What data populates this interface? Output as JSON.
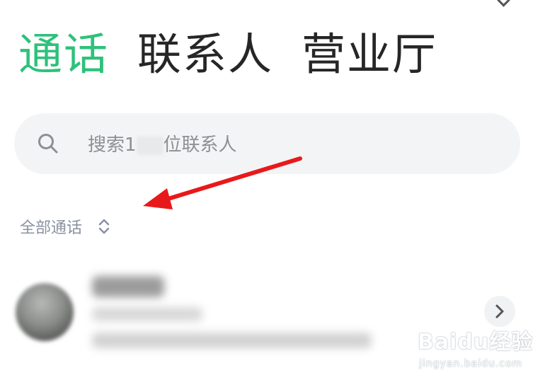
{
  "tabs": [
    {
      "label": "通话",
      "active": true
    },
    {
      "label": "联系人",
      "active": false
    },
    {
      "label": "营业厅",
      "active": false
    }
  ],
  "search": {
    "placeholder_prefix": "搜索1",
    "placeholder_suffix": "位联系人",
    "icon": "search-icon"
  },
  "filter": {
    "label": "全部通话",
    "icon": "sort-updown-icon"
  },
  "contact": {
    "name": "",
    "detail": "",
    "meta": ""
  },
  "colors": {
    "accent": "#2ec17b",
    "arrow": "#e8191b",
    "text": "#262626",
    "muted": "#8b92a3"
  },
  "watermark": {
    "brand": "Bai",
    "brand2": "du",
    "brand3": "经验",
    "url": "jingyan.baidu.com"
  }
}
